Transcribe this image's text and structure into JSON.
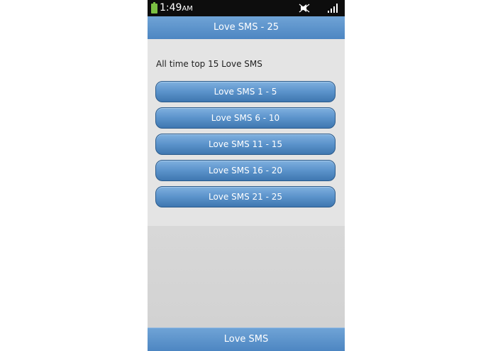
{
  "status_bar": {
    "time": "1:49",
    "ampm": "AM",
    "icons": [
      "battery-icon",
      "mute-icon",
      "signal-icon"
    ]
  },
  "header": {
    "title": "Love SMS - 25"
  },
  "main": {
    "heading": "All time top 15 Love SMS",
    "buttons": [
      {
        "label": "Love SMS 1 - 5"
      },
      {
        "label": "Love SMS 6 - 10"
      },
      {
        "label": "Love SMS 11 - 15"
      },
      {
        "label": "Love SMS 16 - 20"
      },
      {
        "label": "Love SMS 21 - 25"
      }
    ]
  },
  "footer": {
    "label": "Love SMS"
  },
  "colors": {
    "accent": "#5b93cb",
    "button_border": "#2b5b8c",
    "background": "#e4e4e4",
    "battery": "#7bc043"
  }
}
